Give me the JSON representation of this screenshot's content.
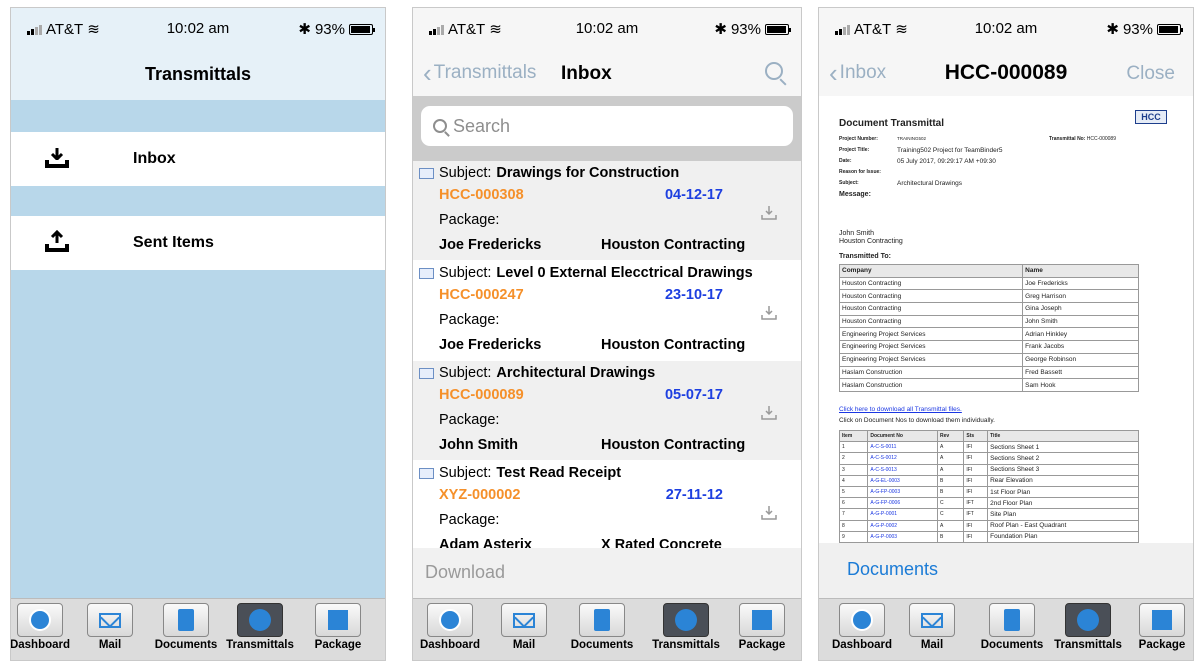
{
  "status": {
    "carrier": "AT&T",
    "time": "10:02 am",
    "battery": "93%"
  },
  "panel1": {
    "title": "Transmittals",
    "items": [
      {
        "label": "Inbox"
      },
      {
        "label": "Sent Items"
      }
    ]
  },
  "tabs": [
    {
      "label": "Dashboard",
      "icon": "dashboard-icon"
    },
    {
      "label": "Mail",
      "icon": "mail-icon"
    },
    {
      "label": "Documents",
      "icon": "documents-icon"
    },
    {
      "label": "Transmittals",
      "icon": "transmittals-icon",
      "active": true
    },
    {
      "label": "Package",
      "icon": "package-icon"
    }
  ],
  "panel2": {
    "back": "Transmittals",
    "title": "Inbox",
    "search_placeholder": "Search",
    "messages": [
      {
        "subject_label": "Subject:",
        "subject": "Drawings for Construction",
        "code": "HCC-000308",
        "date": "04-12-17",
        "package": "Package:",
        "sender": "Joe Fredericks",
        "company": "Houston Contracting"
      },
      {
        "subject_label": "Subject:",
        "subject": "Level 0 External Elecctrical Drawings",
        "code": "HCC-000247",
        "date": "23-10-17",
        "package": "Package:",
        "sender": "Joe Fredericks",
        "company": "Houston Contracting"
      },
      {
        "subject_label": "Subject:",
        "subject": "Architectural Drawings",
        "code": "HCC-000089",
        "date": "05-07-17",
        "package": "Package:",
        "sender": "John Smith",
        "company": "Houston Contracting"
      },
      {
        "subject_label": "Subject:",
        "subject": "Test Read Receipt",
        "code": "XYZ-000002",
        "date": "27-11-12",
        "package": "Package:",
        "sender": "Adam Asterix",
        "company": "X Rated Concrete"
      }
    ],
    "download": "Download"
  },
  "panel3": {
    "back": "Inbox",
    "title": "HCC-000089",
    "close": "Close",
    "doc": {
      "heading": "Document Transmittal",
      "logo": "HCC",
      "project_number_label": "Project Number:",
      "project_number": "TRAINING502",
      "transmittal_no_label": "Transmittal No:",
      "transmittal_no": "HCC-000089",
      "project_title_label": "Project Title:",
      "project_title": "Training502 Project for TeamBinder5",
      "date_label": "Date:",
      "date": "05 July 2017, 09:29:17 AM +09:30",
      "reason_label": "Reason for Issue:",
      "subject_label": "Subject:",
      "subject": "Architectural Drawings",
      "message_label": "Message:",
      "from_name": "John Smith",
      "from_company": "Houston Contracting",
      "transmitted_to": "Transmitted To:",
      "recipients_headers": [
        "Company",
        "Name"
      ],
      "recipients": [
        [
          "Houston Contracting",
          "Joe Fredericks"
        ],
        [
          "Houston Contracting",
          "Greg Harrison"
        ],
        [
          "Houston Contracting",
          "Gina Joseph"
        ],
        [
          "Houston Contracting",
          "John Smith"
        ],
        [
          "Engineering Project Services",
          "Adrian Hinkley"
        ],
        [
          "Engineering Project Services",
          "Frank Jacobs"
        ],
        [
          "Engineering Project Services",
          "George Robinson"
        ],
        [
          "Haslam Construction",
          "Fred Bassett"
        ],
        [
          "Haslam Construction",
          "Sam Hook"
        ]
      ],
      "download_all": "Click here to download all Transmittal files.",
      "note": "Click on Document Nos to download them individually.",
      "doc_headers": [
        "Item",
        "Document No",
        "Rev",
        "Sts",
        "Title"
      ],
      "documents": [
        [
          "1",
          "A-C-S-0011",
          "A",
          "IFI",
          "Sections Sheet 1"
        ],
        [
          "2",
          "A-C-S-0012",
          "A",
          "IFI",
          "Sections Sheet 2"
        ],
        [
          "3",
          "A-C-S-0013",
          "A",
          "IFI",
          "Sections Sheet 3"
        ],
        [
          "4",
          "A-G-EL-0003",
          "B",
          "IFI",
          "Rear Elevation"
        ],
        [
          "5",
          "A-G-FP-0003",
          "B",
          "IFI",
          "1st Floor Plan"
        ],
        [
          "6",
          "A-G-FP-0006",
          "C",
          "IFT",
          "2nd Floor Plan"
        ],
        [
          "7",
          "A-G-P-0001",
          "C",
          "IFT",
          "Site Plan"
        ],
        [
          "8",
          "A-G-P-0002",
          "A",
          "IFI",
          "Roof Plan - East Quadrant"
        ],
        [
          "9",
          "A-G-P-0003",
          "B",
          "IFI",
          "Foundation Plan"
        ]
      ]
    },
    "sheet_label": "Documents"
  }
}
